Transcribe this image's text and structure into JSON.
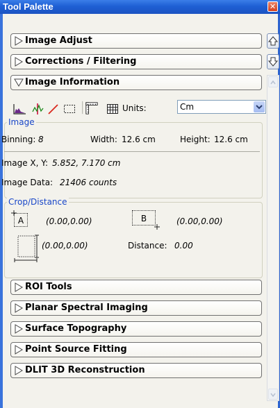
{
  "window": {
    "title": "Tool Palette",
    "close_symbol": "✕"
  },
  "sections": {
    "image_adjust": "Image Adjust",
    "corrections": "Corrections / Filtering",
    "image_information": "Image Information",
    "roi_tools": "ROI Tools",
    "planar_spectral": "Planar Spectral Imaging",
    "surface_topography": "Surface Topography",
    "point_source": "Point Source Fitting",
    "dlit": "DLIT 3D Reconstruction"
  },
  "toolbar": {
    "icons": [
      "histogram-icon",
      "line-profile-icon",
      "draw-line-icon",
      "selection-rect-icon",
      "ruler-icon",
      "grid-icon"
    ],
    "units_label": "Units:",
    "units_value": "Cm"
  },
  "image_group": {
    "title": "Image",
    "binning_label": "Binning:",
    "binning_value": "8",
    "width_label": "Width:",
    "width_value": "12.6 cm",
    "height_label": "Height:",
    "height_value": "12.6 cm",
    "xy_label": "Image  X, Y:",
    "xy_value": "5.852, 7.170 cm",
    "data_label": "Image Data:",
    "data_value": "21406 counts"
  },
  "crop_group": {
    "title": "Crop/Distance",
    "a_label": "A",
    "a_value": "(0.00,0.00)",
    "b_label": "B",
    "b_value": "(0.00,0.00)",
    "size_value": "(0.00,0.00)",
    "distance_label": "Distance:",
    "distance_value": "0.00"
  }
}
